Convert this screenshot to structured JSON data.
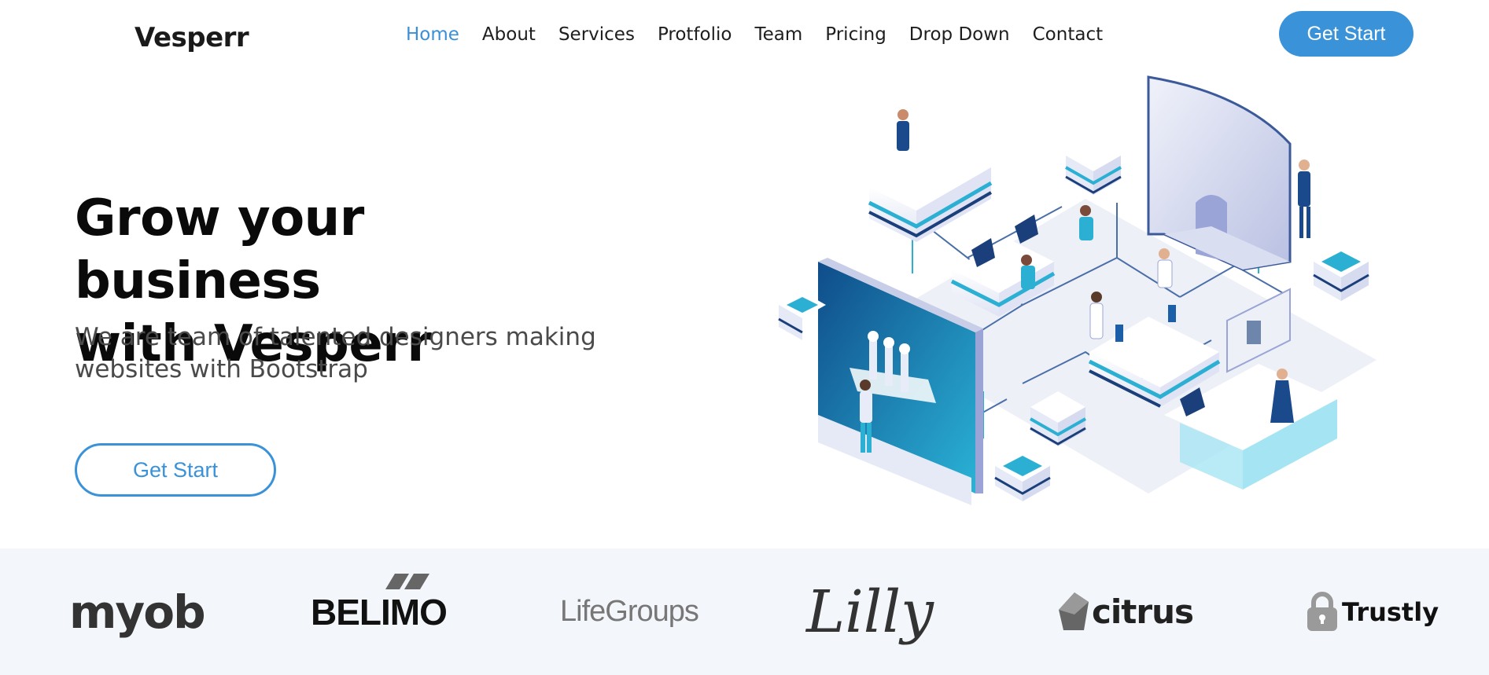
{
  "header": {
    "brand": "Vesperr",
    "nav": [
      {
        "label": "Home",
        "active": true
      },
      {
        "label": "About"
      },
      {
        "label": "Services"
      },
      {
        "label": "Protfolio"
      },
      {
        "label": "Team"
      },
      {
        "label": "Pricing"
      },
      {
        "label": "Drop Down"
      },
      {
        "label": "Contact"
      }
    ],
    "cta_label": "Get Start"
  },
  "hero": {
    "title_line1": "Grow your business",
    "title_line2": "with Vesperr",
    "subtitle": "We are team of talented designers making websites with Bootstrap",
    "cta_label": "Get Start"
  },
  "clients": {
    "logos": [
      {
        "name": "myob",
        "text": "myob"
      },
      {
        "name": "belimo",
        "text": "BELIMO"
      },
      {
        "name": "lifegroups",
        "text": "LifeGroups"
      },
      {
        "name": "lilly",
        "text": "Lilly"
      },
      {
        "name": "citrus",
        "text": "citrus"
      },
      {
        "name": "trustly",
        "text": "Trustly"
      }
    ]
  },
  "colors": {
    "accent": "#3a92d8",
    "clients_bg": "#f3f7fb",
    "text_dark": "#0a0a0a",
    "text_muted": "#4a4a4a"
  }
}
